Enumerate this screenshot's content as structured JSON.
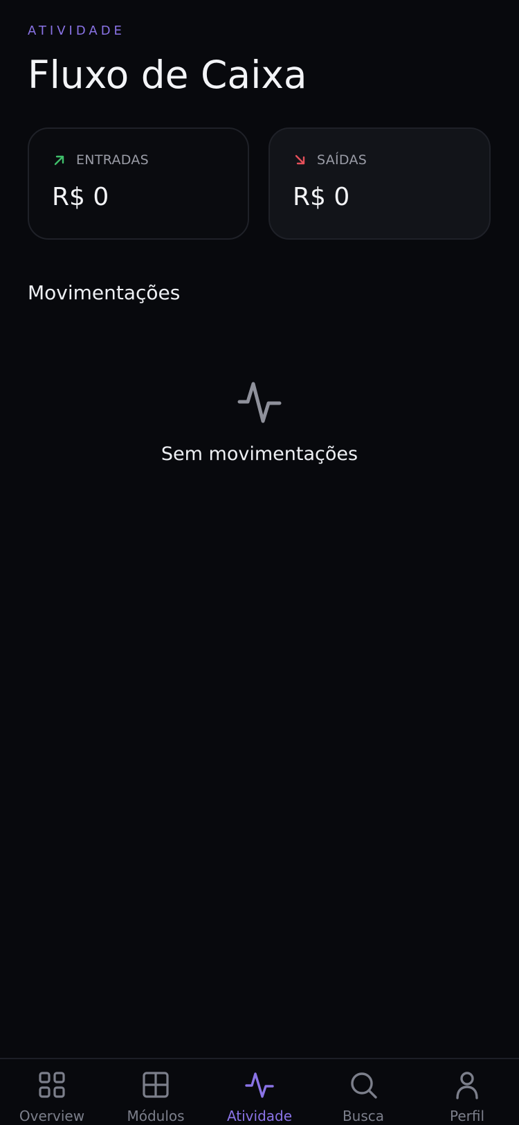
{
  "header": {
    "eyebrow": "ATIVIDADE",
    "title": "Fluxo de Caixa"
  },
  "summary": {
    "inflows": {
      "label": "ENTRADAS",
      "value": "R$ 0",
      "icon": "arrow-up-right-icon",
      "color": "#3fbf6a"
    },
    "outflows": {
      "label": "SAÍDAS",
      "value": "R$ 0",
      "icon": "arrow-down-right-icon",
      "color": "#e5505a"
    }
  },
  "movements": {
    "title": "Movimentações",
    "empty_icon": "activity-icon",
    "empty_text": "Sem movimentações"
  },
  "tabbar": {
    "accent_color": "#8a73e6",
    "inactive_color": "#7c7f8b",
    "tabs": [
      {
        "label": "Overview",
        "icon": "grid-icon",
        "active": false
      },
      {
        "label": "Módulos",
        "icon": "modules-icon",
        "active": false
      },
      {
        "label": "Atividade",
        "icon": "activity-icon",
        "active": true
      },
      {
        "label": "Busca",
        "icon": "search-icon",
        "active": false
      },
      {
        "label": "Perfil",
        "icon": "user-icon",
        "active": false
      }
    ]
  }
}
